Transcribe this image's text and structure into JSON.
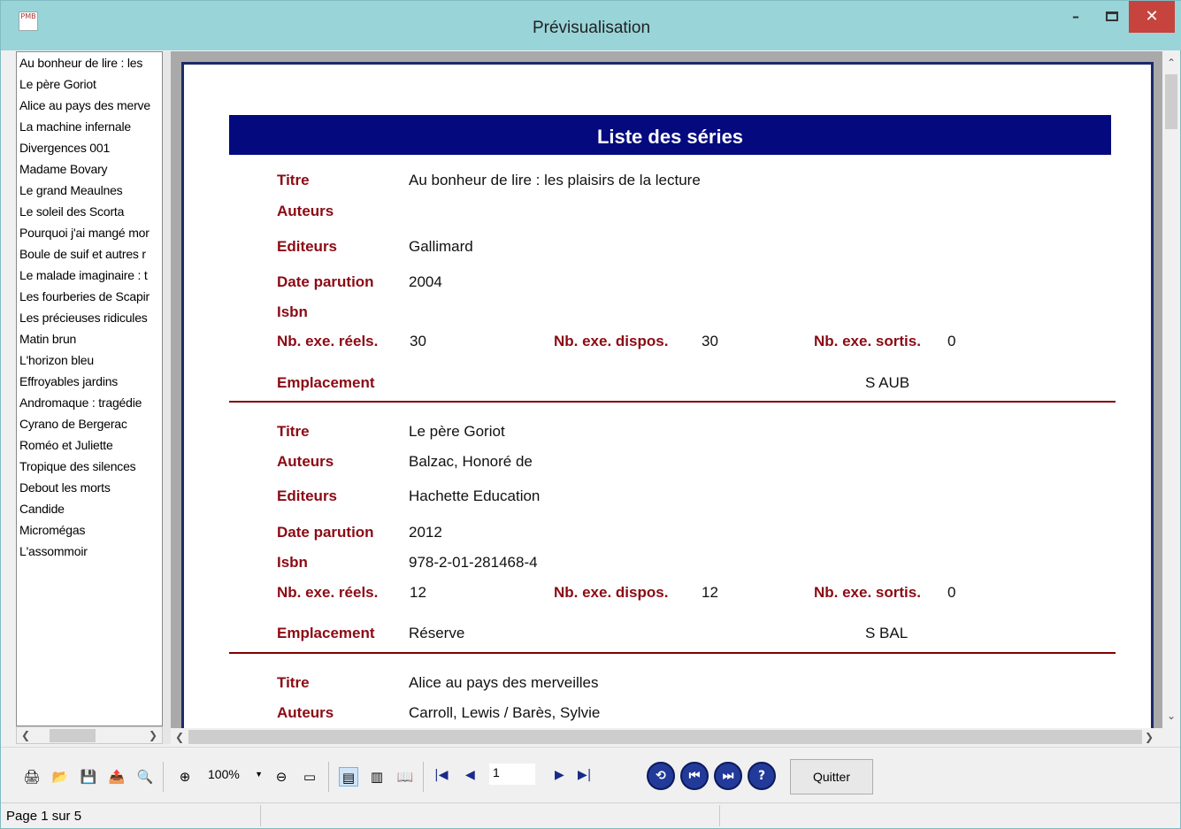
{
  "window": {
    "title": "Prévisualisation",
    "app_icon_text": "PMB",
    "minimize": "–",
    "close": "✕"
  },
  "series_list": [
    "Au bonheur de lire : les",
    "Le père Goriot",
    "Alice au pays des merve",
    "La machine infernale",
    "Divergences 001",
    "Madame Bovary",
    "Le grand Meaulnes",
    "Le soleil des Scorta",
    "Pourquoi j'ai mangé mor",
    "Boule de suif et autres r",
    "Le malade imaginaire : t",
    "Les fourberies de Scapir",
    "Les précieuses ridicules",
    "Matin brun",
    "L'horizon bleu",
    "Effroyables jardins",
    "Andromaque : tragédie",
    "Cyrano de Bergerac",
    "Roméo et Juliette",
    "Tropique des silences",
    "Debout les morts",
    "Candide",
    "Micromégas",
    "L'assommoir"
  ],
  "report": {
    "title": "Liste des séries",
    "labels": {
      "titre": "Titre",
      "auteurs": "Auteurs",
      "editeurs": "Editeurs",
      "date": "Date parution",
      "isbn": "Isbn",
      "reels": "Nb. exe. réels.",
      "dispos": "Nb. exe. dispos.",
      "sortis": "Nb. exe. sortis.",
      "emplacement": "Emplacement"
    },
    "records": [
      {
        "titre": "Au bonheur de lire : les plaisirs de la lecture",
        "auteurs": "",
        "editeurs": "Gallimard",
        "date": "2004",
        "isbn": "",
        "reels": "30",
        "dispos": "30",
        "sortis": "0",
        "emplacement": "",
        "cote": "S AUB"
      },
      {
        "titre": "Le père Goriot",
        "auteurs": "Balzac, Honoré de",
        "editeurs": "Hachette Education",
        "date": "2012",
        "isbn": "978-2-01-281468-4",
        "reels": "12",
        "dispos": "12",
        "sortis": "0",
        "emplacement": "Réserve",
        "cote": "S BAL"
      },
      {
        "titre": "Alice au pays des merveilles",
        "auteurs": "Carroll, Lewis / Barès, Sylvie"
      }
    ]
  },
  "toolbar": {
    "zoom": "100%",
    "page_input": "1",
    "quit_label": "Quitter"
  },
  "status": {
    "page_text": "Page 1 sur 5"
  },
  "colors": {
    "banner": "#040a7e",
    "label": "#8b0a14",
    "separator": "#800000",
    "titlebar": "#99d4d9",
    "close": "#c7433e"
  }
}
